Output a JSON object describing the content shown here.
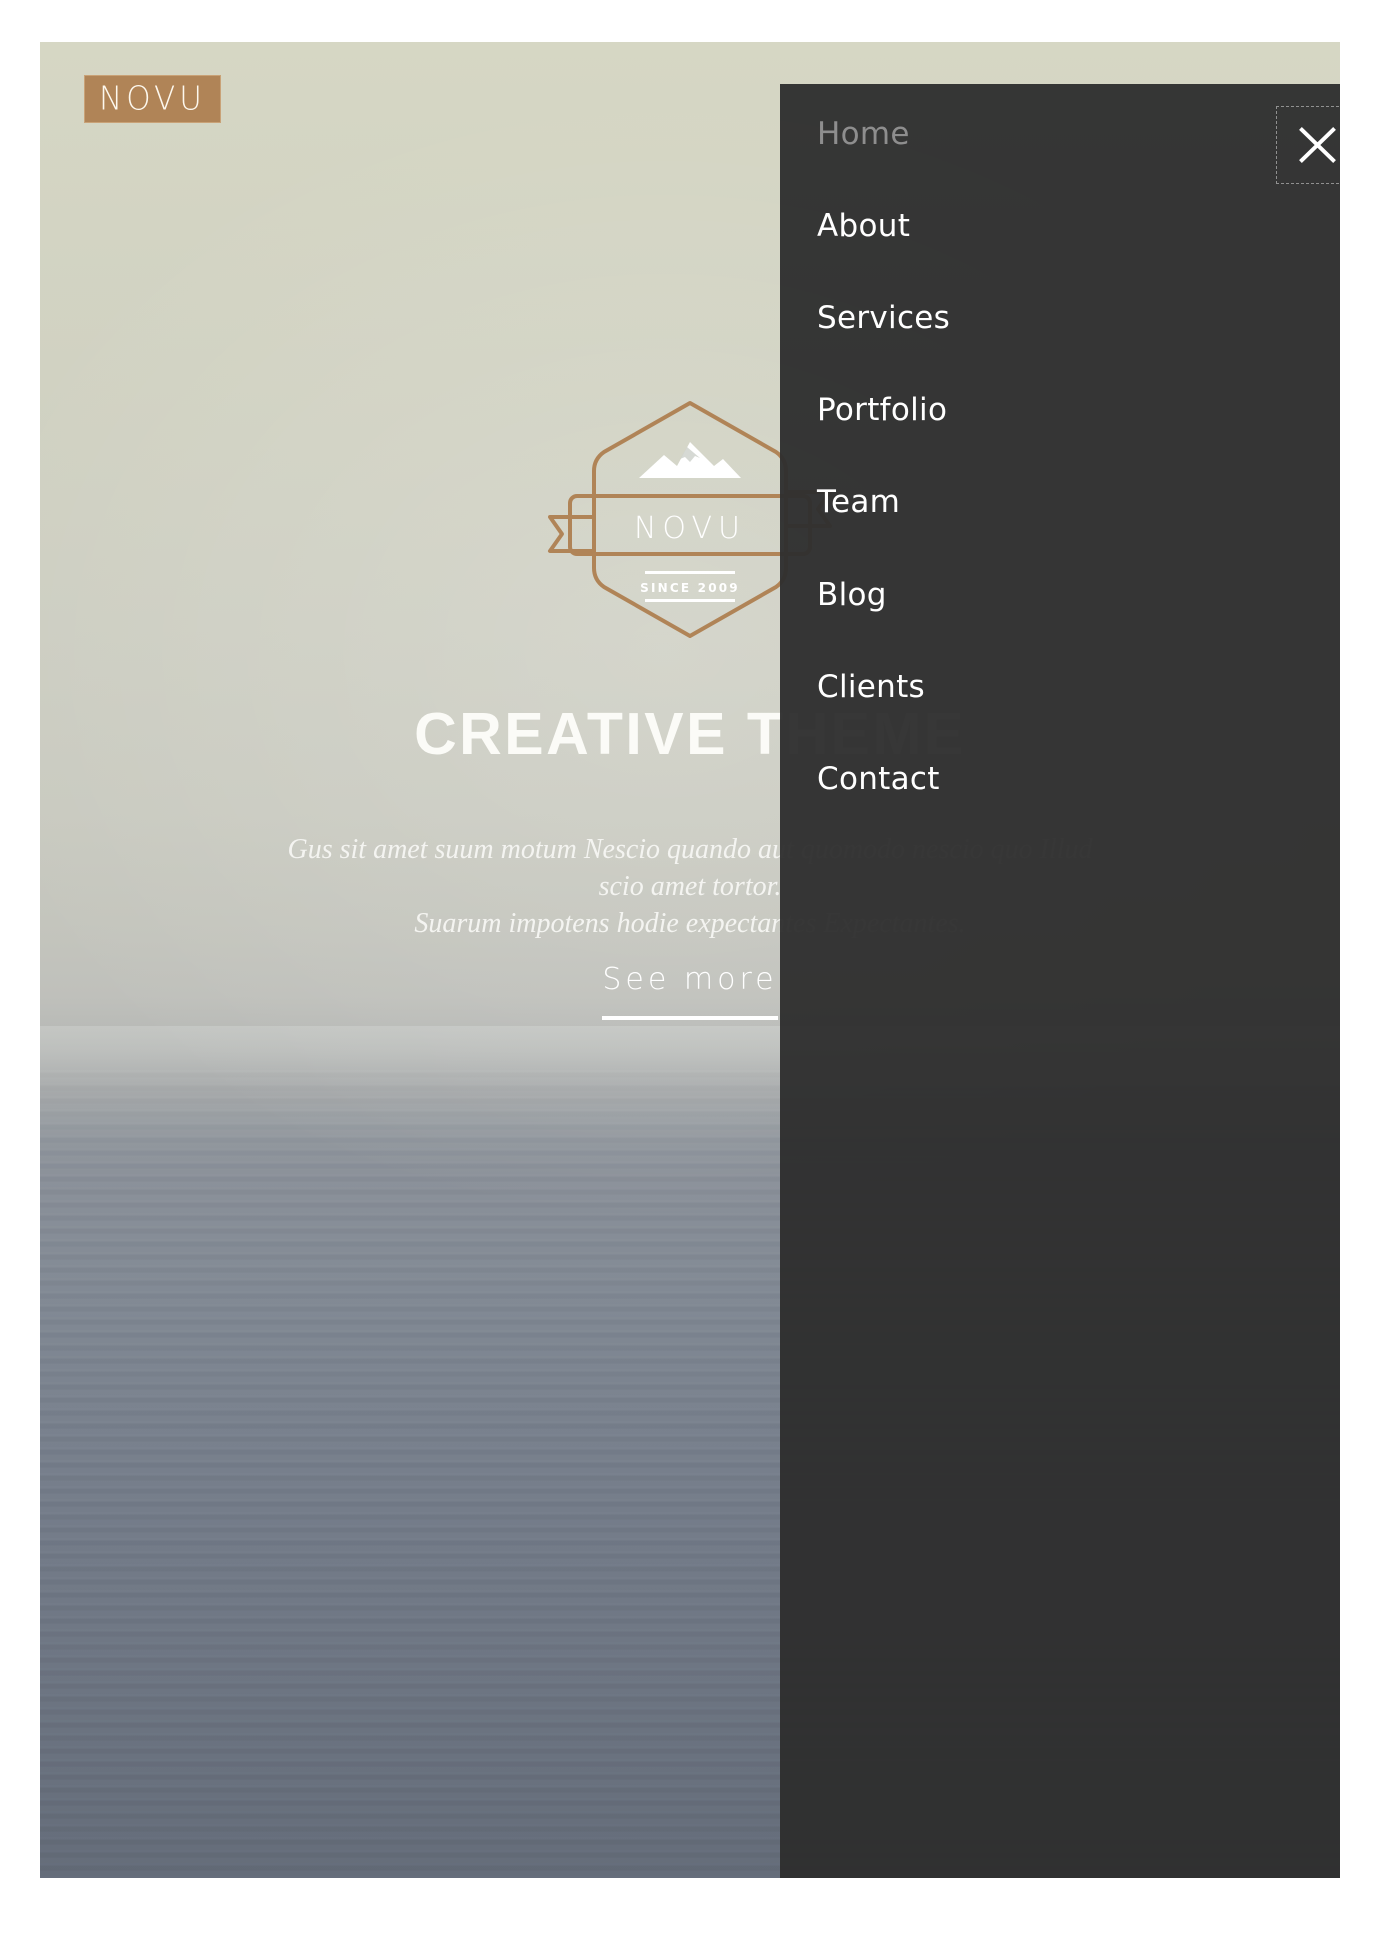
{
  "brand": {
    "name": "NOVU",
    "box_color": "#b08457",
    "text_color": "#fdf8ee"
  },
  "hero": {
    "badge": {
      "wordmark": "NOVU",
      "since": "SINCE 2009",
      "icon": "mountain-icon",
      "outline_color": "#b08457",
      "text_color": "#ffffff"
    },
    "title": "CREATIVE THEME",
    "subtitle_lines": [
      "Gus sit amet suum motum Nescio quando aut quomodo nescio quo Illud",
      "scio amet tortor.",
      "Suarum impotens hodie expectantes Expectantes."
    ],
    "cta_label": "See more"
  },
  "nav": {
    "panel_color": "#2e2e2e",
    "close_icon": "close-icon",
    "items": [
      {
        "label": "Home",
        "state": "muted"
      },
      {
        "label": "About",
        "state": "normal"
      },
      {
        "label": "Services",
        "state": "normal"
      },
      {
        "label": "Portfolio",
        "state": "normal"
      },
      {
        "label": "Team",
        "state": "normal"
      },
      {
        "label": "Blog",
        "state": "normal"
      },
      {
        "label": "Clients",
        "state": "normal"
      },
      {
        "label": "Contact",
        "state": "normal"
      }
    ]
  }
}
